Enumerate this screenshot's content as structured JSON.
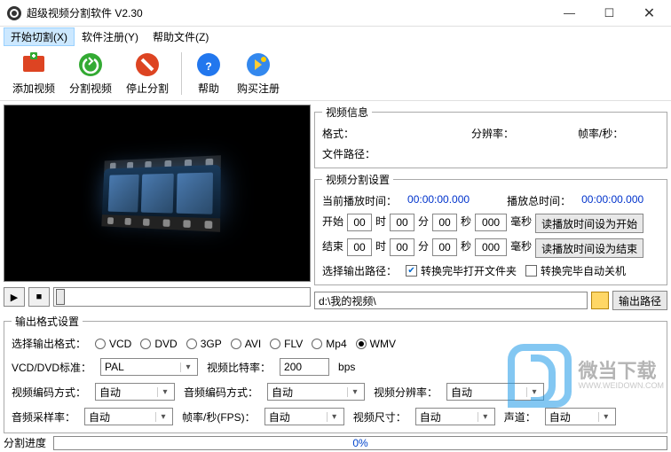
{
  "window": {
    "title": "超级视频分割软件 V2.30"
  },
  "menu": {
    "start": "开始切割(X)",
    "register": "软件注册(Y)",
    "help": "帮助文件(Z)"
  },
  "toolbar": {
    "add": "添加视频",
    "split": "分割视频",
    "stop": "停止分割",
    "help": "帮助",
    "buy": "购买注册"
  },
  "info": {
    "legend": "视频信息",
    "format_lbl": "格式：",
    "res_lbl": "分辨率：",
    "fps_lbl": "帧率/秒：",
    "path_lbl": "文件路径："
  },
  "splitset": {
    "legend": "视频分割设置",
    "cur_lbl": "当前播放时间：",
    "cur_val": "00:00:00.000",
    "total_lbl": "播放总时间：",
    "total_val": "00:00:00.000",
    "start_lbl": "开始",
    "end_lbl": "结束",
    "h": "00",
    "m": "00",
    "s": "00",
    "ms": "000",
    "h_u": "时",
    "m_u": "分",
    "s_u": "秒",
    "ms_u": "毫秒",
    "btn_start": "读播放时间设为开始",
    "btn_end": "读播放时间设为结束",
    "outpath_lbl": "选择输出路径：",
    "cb_open": "转换完毕打开文件夹",
    "cb_shutdown": "转换完毕自动关机",
    "path_val": "d:\\我的视频\\",
    "path_btn": "输出路径"
  },
  "fmt": {
    "legend": "输出格式设置",
    "sel_lbl": "选择输出格式：",
    "opts": [
      "VCD",
      "DVD",
      "3GP",
      "AVI",
      "FLV",
      "Mp4",
      "WMV"
    ],
    "selected": "WMV",
    "std_lbl": "VCD/DVD标准：",
    "std_val": "PAL",
    "vbit_lbl": "视频比特率：",
    "vbit_val": "200",
    "vbit_unit": "bps",
    "venc_lbl": "视频编码方式：",
    "venc_val": "自动",
    "aenc_lbl": "音频编码方式：",
    "aenc_val": "自动",
    "vres_lbl": "视频分辨率：",
    "vres_val": "自动",
    "asr_lbl": "音频采样率：",
    "asr_val": "自动",
    "fps_lbl": "帧率/秒(FPS)：",
    "fps_val": "自动",
    "vsize_lbl": "视频尺寸：",
    "vsize_val": "自动",
    "ch_lbl": "声道：",
    "ch_val": "自动"
  },
  "status": {
    "progress_lbl": "分割进度",
    "progress_val": "0%"
  },
  "watermark": {
    "text": "微当下载",
    "url": "WWW.WEIDOWN.COM"
  }
}
